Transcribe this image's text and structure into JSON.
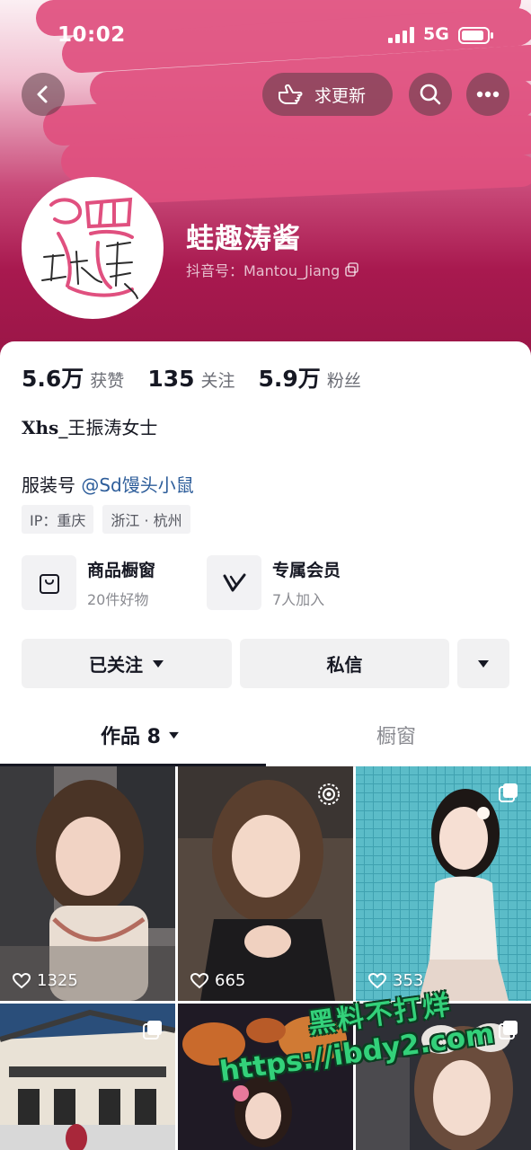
{
  "status_bar": {
    "time": "10:02",
    "network": "5G"
  },
  "header": {
    "request_update_label": "求更新",
    "nickname": "蛙趣涛酱",
    "douyin_id": "抖音号：Mantou_Jiang"
  },
  "stats": [
    {
      "value": "5.6万",
      "label": "获赞"
    },
    {
      "value": "135",
      "label": "关注"
    },
    {
      "value": "5.9万",
      "label": "粉丝"
    }
  ],
  "bio": {
    "line1_prefix": "Xhs",
    "line1_rest": "_王振涛女士",
    "line2_prefix": "服装号 ",
    "line2_mention": "@Sd馒头小鼠"
  },
  "tags": [
    "IP：重庆",
    "浙江 · 杭州"
  ],
  "features": {
    "shop": {
      "title": "商品橱窗",
      "subtitle": "20件好物"
    },
    "member": {
      "title": "专属会员",
      "subtitle": "7人加入"
    }
  },
  "actions": {
    "follow": "已关注",
    "message": "私信"
  },
  "tabs": {
    "works": "作品 8",
    "window": "橱窗"
  },
  "grid": {
    "likes": [
      "1325",
      "665",
      "353"
    ]
  },
  "watermark": {
    "line1": "黑料不打烊",
    "line2": "https://ibdy2.com"
  },
  "colors": {
    "header_top": "#fbeff3",
    "header_bottom": "#9a1647",
    "scribble": "#e0507f",
    "mention": "#2d5d9a"
  }
}
